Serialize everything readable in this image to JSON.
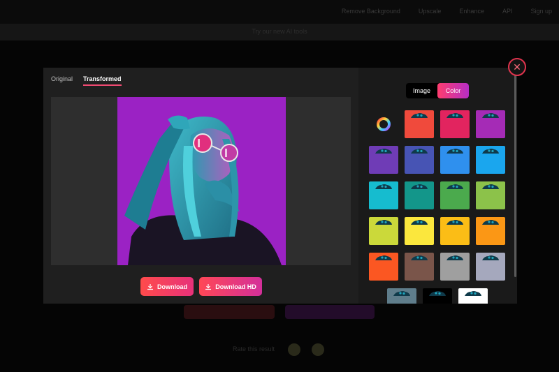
{
  "background_page": {
    "nav_items": [
      "Remove Background",
      "Upscale",
      "Enhance",
      "API",
      "Sign up"
    ],
    "strip_text": "Try our new AI tools ",
    "rate_text": "Rate this result"
  },
  "modal": {
    "tabs": [
      {
        "label": "Original",
        "active": false
      },
      {
        "label": "Transformed",
        "active": true
      }
    ],
    "image": {
      "subject": "woman with round sunglasses, neon teal lighting",
      "background_color": "#9b22c4"
    },
    "buttons": {
      "download_label": "Download",
      "download_hd_label": "Download HD"
    },
    "mode_toggle": {
      "image_label": "Image",
      "color_label": "Color",
      "selected": "Color"
    },
    "swatches": [
      "color-picker",
      "#f04a3c",
      "#e2245f",
      "#a52bb6",
      "#6f3cb6",
      "#4754b4",
      "#2f90ee",
      "#1aa6ee",
      "#16bccf",
      "#13968a",
      "#4baa4d",
      "#8cc24a",
      "#cbd93a",
      "#fbe73d",
      "#fbbd16",
      "#fb9715",
      "#fb5722",
      "#7a554a",
      "#9f9f9f",
      "#a5a8bd",
      "#5f7d8b",
      "#000000",
      "#ffffff"
    ],
    "accent_color": "#f04a72"
  }
}
